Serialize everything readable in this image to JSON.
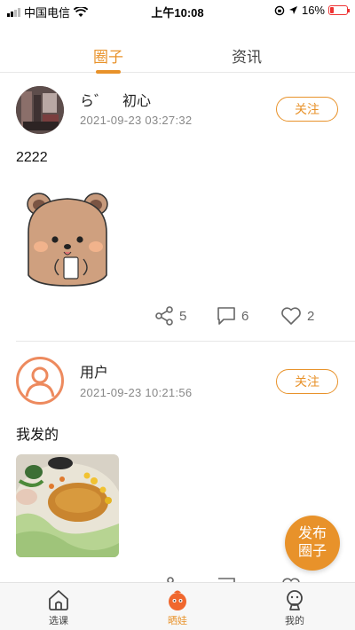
{
  "status_bar": {
    "carrier": "中国电信",
    "time": "上午10:08",
    "battery": "16%"
  },
  "tabs": [
    {
      "label": "圈子",
      "active": true
    },
    {
      "label": "资讯",
      "active": false
    }
  ],
  "posts": [
    {
      "username": "ら゛　初心",
      "timestamp": "2021-09-23 03:27:32",
      "follow_label": "关注",
      "text": "2222",
      "image_icon": "bear-sticker",
      "shares": "5",
      "comments": "6",
      "likes": "2"
    },
    {
      "username": "用户",
      "timestamp": "2021-09-23 10:21:56",
      "follow_label": "关注",
      "text": "我发的",
      "image_icon": "food-photo"
    }
  ],
  "fab": {
    "label": "发布圈子"
  },
  "bottom_nav": [
    {
      "label": "选课",
      "icon": "home-icon"
    },
    {
      "label": "晒娃",
      "icon": "mascot-icon",
      "active": true
    },
    {
      "label": "我的",
      "icon": "profile-icon"
    }
  ],
  "colors": {
    "accent": "#e8922a",
    "avatar_ring": "#ed8a5e"
  }
}
